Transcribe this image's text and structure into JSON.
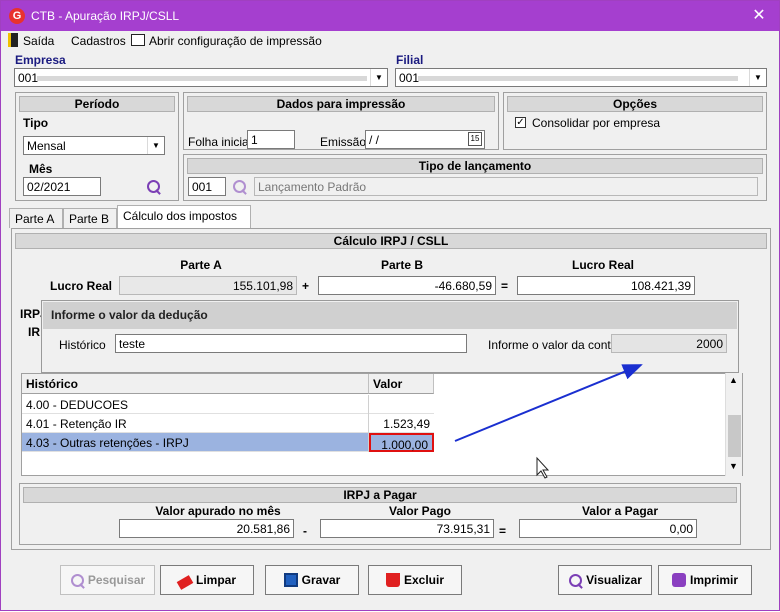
{
  "window": {
    "title": "CTB - Apuração IRPJ/CSLL",
    "close": "✕",
    "icon": "G"
  },
  "menu": {
    "exit": "Saída",
    "records": "Cadastros",
    "print_config": "Abrir configuração de impressão"
  },
  "company": {
    "label": "Empresa",
    "value": "001"
  },
  "branch": {
    "label": "Filial",
    "value": "001"
  },
  "period": {
    "header": "Período",
    "type_label": "Tipo",
    "type_value": "Mensal",
    "month_label": "Mês",
    "month_value": "02/2021"
  },
  "print_data": {
    "header": "Dados para impressão",
    "initial_page_label": "Folha inicial",
    "initial_page_value": "1",
    "emission_label": "Emissão",
    "emission_value": " / /",
    "calendar_icon": "15"
  },
  "options": {
    "header": "Opções",
    "consolidate_label": "Consolidar por empresa",
    "consolidate_checked": true
  },
  "entry_type": {
    "header": "Tipo de lançamento",
    "code": "001",
    "description": "Lançamento Padrão"
  },
  "tabs": [
    "Parte A",
    "Parte B",
    "Cálculo dos impostos"
  ],
  "calc": {
    "header": "Cálculo IRPJ / CSLL",
    "row_label": "Lucro Real",
    "col_a": "Parte A",
    "col_b": "Parte B",
    "col_result": "Lucro Real",
    "value_a": "155.101,98",
    "plus": "+",
    "value_b": "-46.680,59",
    "equals": "=",
    "value_result": "108.421,39"
  },
  "hidden_tab": {
    "label": "IRPJ",
    "sub_label": "IR"
  },
  "dialog": {
    "title": "Informe o valor da dedução",
    "history_label": "Histórico",
    "history_value": "teste",
    "amount_label": "Informe o valor da conta",
    "amount_value": "2000"
  },
  "grid": {
    "col_history": "Histórico",
    "col_value": "Valor",
    "rows": [
      {
        "history": "4.00 - DEDUCOES",
        "value": ""
      },
      {
        "history": "4.01 - Retenção IR",
        "value": "1.523,49"
      },
      {
        "history": "4.03 - Outras retenções - IRPJ",
        "value": "1.000,00"
      }
    ]
  },
  "pay": {
    "header": "IRPJ a Pagar",
    "col_computed": "Valor apurado no mês",
    "col_paid": "Valor Pago",
    "col_due": "Valor a Pagar",
    "computed": "20.581,86",
    "minus": "-",
    "paid": "73.915,31",
    "equals": "=",
    "due": "0,00"
  },
  "buttons": {
    "search": "Pesquisar",
    "clear": "Limpar",
    "save": "Gravar",
    "delete": "Excluir",
    "view": "Visualizar",
    "print": "Imprimir"
  },
  "colors": {
    "titlebar": "#a53fcf",
    "accent_red": "#e01010",
    "arrow_blue": "#1a2fd0",
    "selection": "#9bb3e0"
  }
}
